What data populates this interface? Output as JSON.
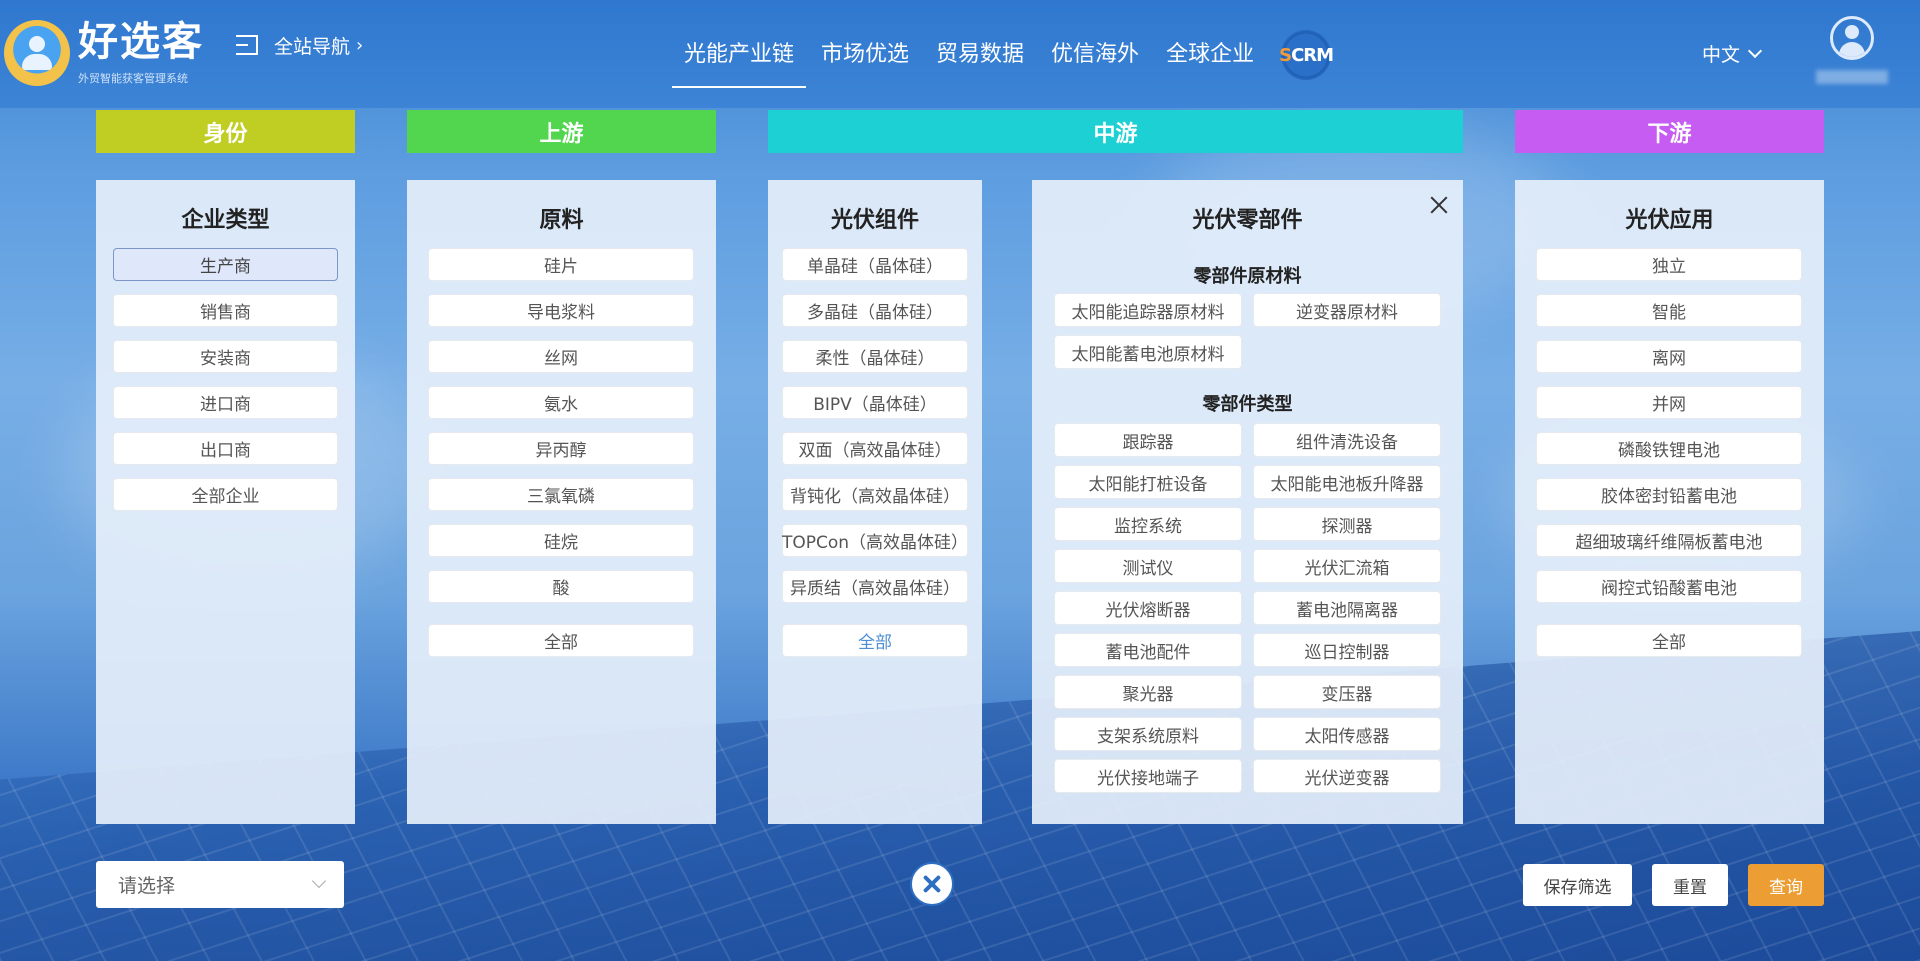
{
  "header": {
    "logo_title": "好选客",
    "logo_subtitle": "外贸智能获客管理系统",
    "site_nav_label": "全站导航",
    "nav": [
      "光能产业链",
      "市场优选",
      "贸易数据",
      "优信海外",
      "全球企业"
    ],
    "active_nav": "光能产业链",
    "scrm_prefix": "S",
    "scrm_rest": "CRM",
    "language": "中文"
  },
  "categories": {
    "identity": "身份",
    "upstream": "上游",
    "midstream": "中游",
    "downstream": "下游"
  },
  "colors": {
    "identity": "#c0cd22",
    "upstream": "#53d64f",
    "midstream": "#1dd0d3",
    "downstream": "#c75cf3",
    "header": "#2f78cf",
    "query_button": "#ec9d33"
  },
  "columns": {
    "enterprise_type": {
      "title": "企业类型",
      "options": [
        "生产商",
        "销售商",
        "安装商",
        "进口商",
        "出口商",
        "全部企业"
      ],
      "selected": "生产商"
    },
    "raw_materials": {
      "title": "原料",
      "options": [
        "硅片",
        "导电浆料",
        "丝网",
        "氨水",
        "异丙醇",
        "三氯氧磷",
        "硅烷",
        "酸"
      ],
      "all_label": "全部"
    },
    "pv_modules": {
      "title": "光伏组件",
      "options": [
        "单晶硅（晶体硅）",
        "多晶硅（晶体硅）",
        "柔性（晶体硅）",
        "BIPV（晶体硅）",
        "双面（高效晶体硅）",
        "背钝化（高效晶体硅）",
        "TOPCon（高效晶体硅）",
        "异质结（高效晶体硅）"
      ],
      "all_label": "全部"
    },
    "pv_parts": {
      "title": "光伏零部件",
      "raw_title": "零部件原材料",
      "raw_options": [
        "太阳能追踪器原材料",
        "逆变器原材料",
        "太阳能蓄电池原材料"
      ],
      "type_title": "零部件类型",
      "type_options": [
        "跟踪器",
        "组件清洗设备",
        "太阳能打桩设备",
        "太阳能电池板升降器",
        "监控系统",
        "探测器",
        "测试仪",
        "光伏汇流箱",
        "光伏熔断器",
        "蓄电池隔离器",
        "蓄电池配件",
        "巡日控制器",
        "聚光器",
        "变压器",
        "支架系统原料",
        "太阳传感器",
        "光伏接地端子",
        "光伏逆变器"
      ]
    },
    "pv_applications": {
      "title": "光伏应用",
      "options": [
        "独立",
        "智能",
        "离网",
        "并网",
        "磷酸铁锂电池",
        "胶体密封铅蓄电池",
        "超细玻璃纤维隔板蓄电池",
        "阀控式铅酸蓄电池"
      ],
      "all_label": "全部"
    }
  },
  "footer": {
    "select_placeholder": "请选择",
    "save_filter": "保存筛选",
    "reset": "重置",
    "query": "查询"
  }
}
